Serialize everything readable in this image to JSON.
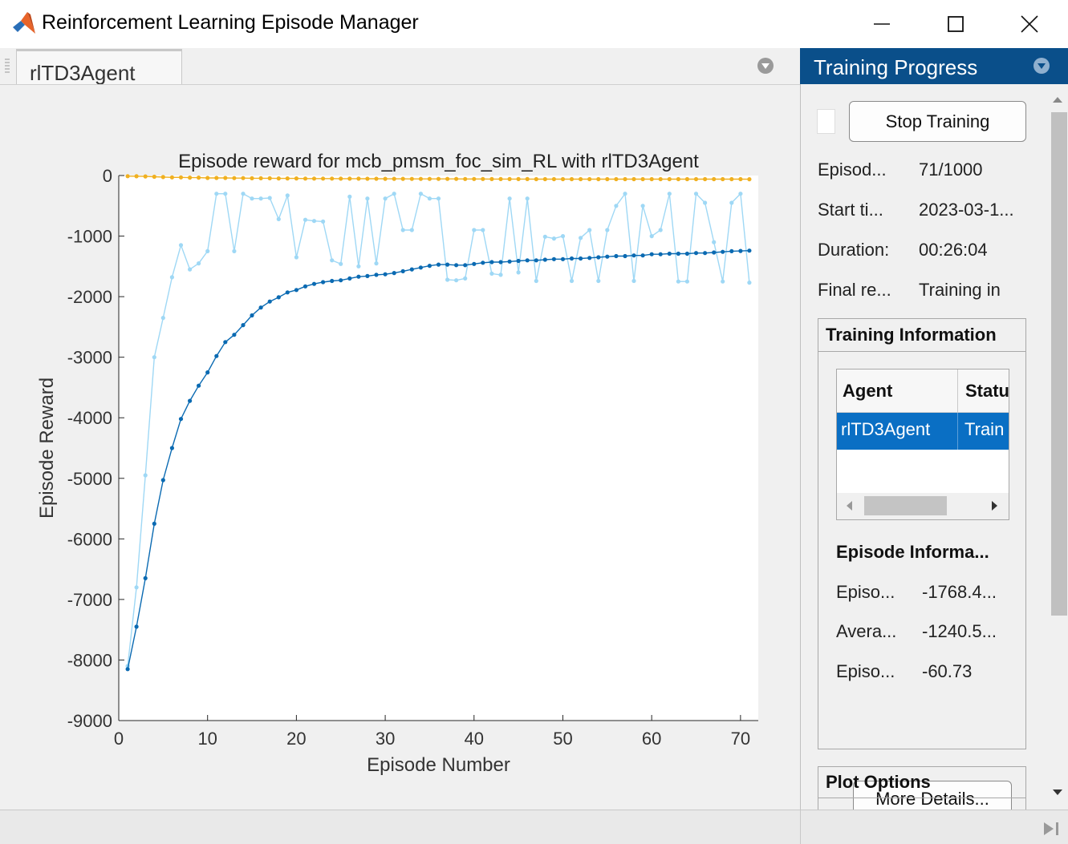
{
  "window": {
    "title": "Reinforcement Learning Episode Manager"
  },
  "document_tab": {
    "label": "rlTD3Agent"
  },
  "right_panel": {
    "header": "Training Progress",
    "stop_button": "Stop Training",
    "info_rows": [
      {
        "label": "Episod...",
        "value": "71/1000"
      },
      {
        "label": "Start ti...",
        "value": "2023-03-1..."
      },
      {
        "label": "Duration:",
        "value": "00:26:04"
      },
      {
        "label": "Final re...",
        "value": "Training in"
      }
    ],
    "training_info": {
      "title": "Training Information",
      "columns": [
        "Agent",
        "Statu"
      ],
      "row": [
        "rlTD3Agent",
        "Train"
      ]
    },
    "episode_info": {
      "title": "Episode Informa...",
      "rows": [
        {
          "label": "Episo...",
          "value": "-1768.4..."
        },
        {
          "label": "Avera...",
          "value": "-1240.5..."
        },
        {
          "label": "Episo...",
          "value": "-60.73"
        }
      ],
      "more_button": "More Details..."
    },
    "plot_options": {
      "title": "Plot Options"
    }
  },
  "colors": {
    "header_blue": "#0a4f8a",
    "selection_blue": "#0a6fc4",
    "episode_reward": "#9fd8f5",
    "average_reward": "#0a6ab2",
    "episode_q0": "#f0b020"
  },
  "chart_data": {
    "type": "line",
    "title": "Episode reward for mcb_pmsm_foc_sim_RL with rlTD3Agent",
    "xlabel": "Episode Number",
    "ylabel": "Episode Reward",
    "xlim": [
      0,
      72
    ],
    "ylim": [
      -9000,
      0
    ],
    "xticks": [
      0,
      10,
      20,
      30,
      40,
      50,
      60,
      70
    ],
    "yticks": [
      0,
      -1000,
      -2000,
      -3000,
      -4000,
      -5000,
      -6000,
      -7000,
      -8000,
      -9000
    ],
    "grid": false,
    "legend": false,
    "x": [
      1,
      2,
      3,
      4,
      5,
      6,
      7,
      8,
      9,
      10,
      11,
      12,
      13,
      14,
      15,
      16,
      17,
      18,
      19,
      20,
      21,
      22,
      23,
      24,
      25,
      26,
      27,
      28,
      29,
      30,
      31,
      32,
      33,
      34,
      35,
      36,
      37,
      38,
      39,
      40,
      41,
      42,
      43,
      44,
      45,
      46,
      47,
      48,
      49,
      50,
      51,
      52,
      53,
      54,
      55,
      56,
      57,
      58,
      59,
      60,
      61,
      62,
      63,
      64,
      65,
      66,
      67,
      68,
      69,
      70,
      71
    ],
    "series": [
      {
        "values": [
          -8100,
          -6800,
          -4950,
          -3000,
          -2350,
          -1680,
          -1150,
          -1550,
          -1450,
          -1250,
          -300,
          -300,
          -1250,
          -300,
          -380,
          -380,
          -370,
          -720,
          -330,
          -1350,
          -730,
          -750,
          -760,
          -1400,
          -1460,
          -350,
          -1500,
          -380,
          -1450,
          -380,
          -300,
          -900,
          -900,
          -300,
          -380,
          -380,
          -1720,
          -1730,
          -1700,
          -900,
          -900,
          -1620,
          -1640,
          -380,
          -1600,
          -380,
          -1740,
          -1010,
          -1040,
          -1000,
          -1740,
          -1030,
          -900,
          -1740,
          -900,
          -500,
          -300,
          -1740,
          -500,
          -1000,
          -900,
          -300,
          -1750,
          -1750,
          -300,
          -450,
          -1100,
          -1750,
          -450,
          -300,
          -1768.4
        ],
        "color": "#9fd8f5"
      },
      {
        "values": [
          -8150,
          -7450,
          -6650,
          -5750,
          -5030,
          -4500,
          -4020,
          -3720,
          -3470,
          -3250,
          -2980,
          -2750,
          -2630,
          -2470,
          -2310,
          -2180,
          -2080,
          -2010,
          -1930,
          -1890,
          -1830,
          -1790,
          -1760,
          -1740,
          -1730,
          -1700,
          -1670,
          -1660,
          -1640,
          -1630,
          -1610,
          -1580,
          -1550,
          -1520,
          -1490,
          -1470,
          -1470,
          -1480,
          -1480,
          -1460,
          -1440,
          -1430,
          -1430,
          -1420,
          -1410,
          -1400,
          -1400,
          -1390,
          -1380,
          -1380,
          -1370,
          -1370,
          -1360,
          -1350,
          -1340,
          -1330,
          -1330,
          -1320,
          -1320,
          -1300,
          -1300,
          -1290,
          -1290,
          -1290,
          -1280,
          -1280,
          -1270,
          -1260,
          -1250,
          -1245,
          -1240.5
        ],
        "color": "#0a6ab2"
      },
      {
        "values": [
          -10,
          -12,
          -15,
          -20,
          -25,
          -30,
          -30,
          -35,
          -35,
          -40,
          -40,
          -40,
          -42,
          -42,
          -45,
          -45,
          -45,
          -47,
          -48,
          -48,
          -50,
          -50,
          -50,
          -50,
          -52,
          -52,
          -52,
          -53,
          -53,
          -54,
          -54,
          -54,
          -55,
          -55,
          -55,
          -56,
          -56,
          -56,
          -57,
          -57,
          -57,
          -58,
          -58,
          -58,
          -58,
          -58,
          -59,
          -59,
          -59,
          -59,
          -59,
          -59,
          -60,
          -60,
          -60,
          -60,
          -60,
          -60,
          -60,
          -60,
          -60,
          -60,
          -60,
          -60,
          -60,
          -60,
          -60,
          -60,
          -60,
          -60,
          -60.73
        ],
        "color": "#f0b020"
      }
    ]
  }
}
